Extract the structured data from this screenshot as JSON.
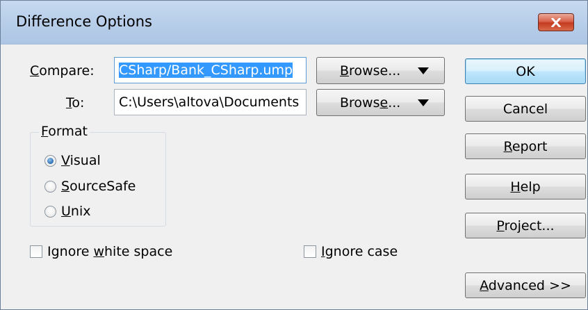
{
  "window": {
    "title": "Difference Options",
    "close_icon": "close-icon"
  },
  "compare": {
    "label_accel": "C",
    "label_rest": "ompare:",
    "value": "CSharp/Bank_CSharp.ump",
    "browse_accel": "B",
    "browse_rest": "rowse...",
    "browse_icon": "dropdown-arrow-icon"
  },
  "to": {
    "label_accel": "T",
    "label_rest": "o:",
    "value": "C:\\Users\\altova\\Documents",
    "browse_pre": "Brows",
    "browse_accel": "e",
    "browse_post": "...",
    "browse_icon": "dropdown-arrow-icon"
  },
  "format": {
    "label_accel": "F",
    "label_rest": "ormat",
    "options": [
      {
        "accel": "V",
        "rest": "isual",
        "selected": true
      },
      {
        "accel": "S",
        "rest": "ourceSafe",
        "selected": false
      },
      {
        "accel": "U",
        "rest": "nix",
        "selected": false
      }
    ]
  },
  "options": {
    "ignore_white_space": {
      "pre": "Ignore ",
      "accel": "w",
      "post": "hite space",
      "checked": false
    },
    "ignore_case": {
      "accel": "I",
      "rest": "gnore case",
      "checked": false
    }
  },
  "buttons": {
    "ok": "OK",
    "cancel": "Cancel",
    "report_accel": "R",
    "report_rest": "eport",
    "help_accel": "H",
    "help_rest": "elp",
    "project_accel": "P",
    "project_rest": "roject...",
    "advanced_accel": "A",
    "advanced_rest": "dvanced >>"
  },
  "colors": {
    "selection": "#3399ff",
    "close_button": "#c43c21",
    "default_button_border": "#3c7fb1"
  }
}
